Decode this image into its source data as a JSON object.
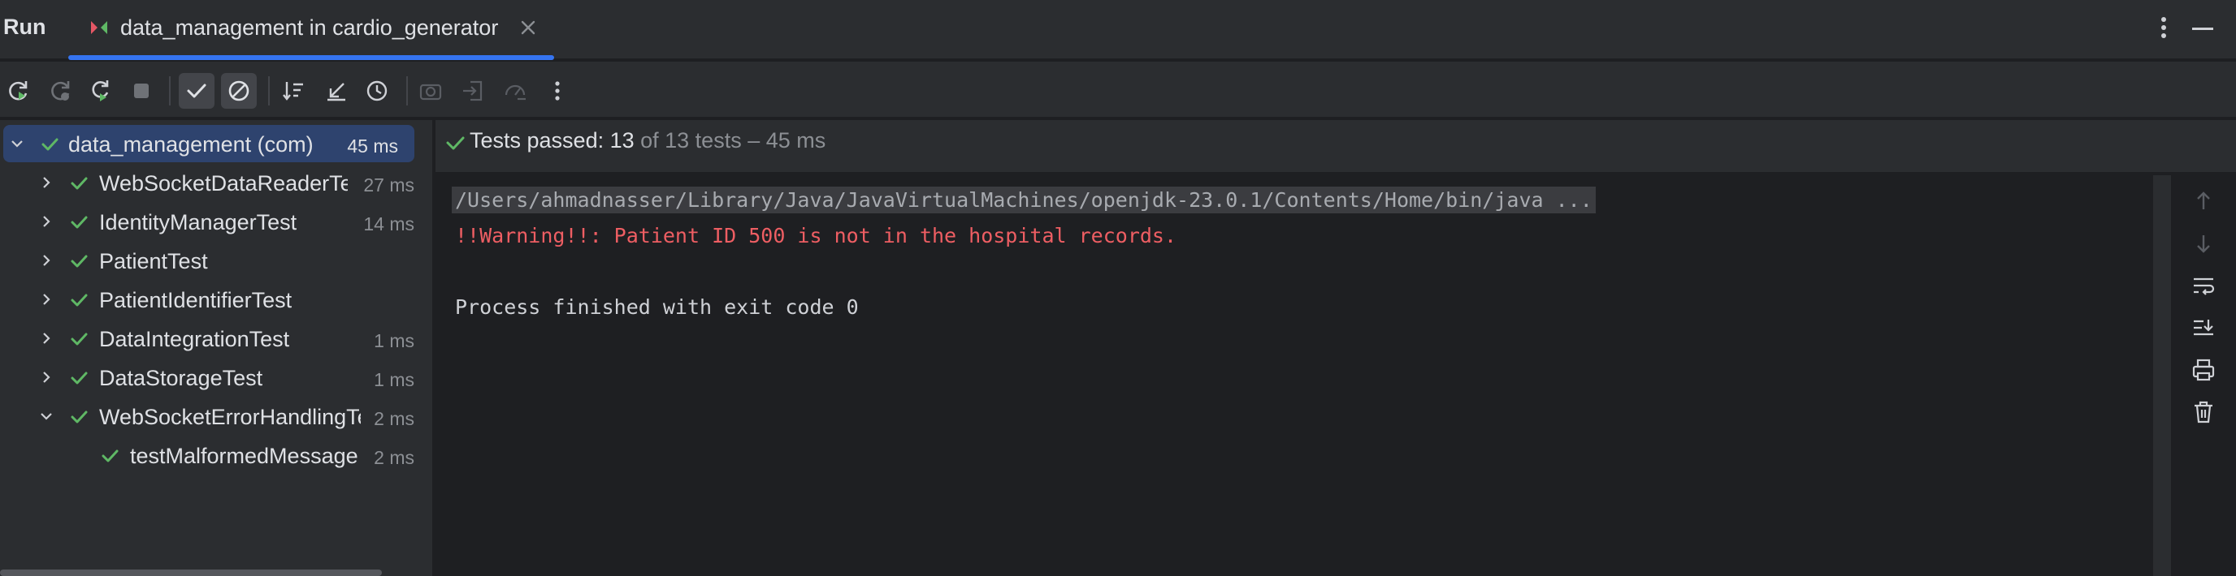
{
  "header": {
    "run_title": "Run",
    "tab_label": "data_management in cardio_generator"
  },
  "status": {
    "label": "Tests passed: 13",
    "rest": " of 13 tests – 45 ms"
  },
  "tree": {
    "rows": [
      {
        "label": "data_management (com)",
        "time": "45 ms"
      },
      {
        "label": "WebSocketDataReaderTest",
        "time": "27 ms"
      },
      {
        "label": "IdentityManagerTest",
        "time": "14 ms"
      },
      {
        "label": "PatientTest",
        "time": ""
      },
      {
        "label": "PatientIdentifierTest",
        "time": ""
      },
      {
        "label": "DataIntegrationTest",
        "time": "1 ms"
      },
      {
        "label": "DataStorageTest",
        "time": "1 ms"
      },
      {
        "label": "WebSocketErrorHandlingTest",
        "time": "2 ms"
      },
      {
        "label": "testMalformedMessage",
        "time": "2 ms"
      }
    ]
  },
  "console": {
    "command": "/Users/ahmadnasser/Library/Java/JavaVirtualMachines/openjdk-23.0.1/Contents/Home/bin/java ...",
    "warning": "!!Warning!!: Patient ID 500 is not in the hospital records.",
    "finished": "Process finished with exit code 0"
  },
  "colors": {
    "accent": "#3574f0",
    "success": "#5fb865",
    "error": "#ee5e63",
    "selection": "#2e436e"
  },
  "icons": {
    "toolbar": [
      "rerun-icon",
      "rerun-failed-icon",
      "toggle-auto-test-icon",
      "stop-icon",
      "show-passed-icon",
      "show-ignored-icon",
      "sort-alphabetically-icon",
      "collapse-all-icon",
      "sort-by-duration-icon",
      "screenshot-icon",
      "import-tests-icon",
      "export-tests-icon",
      "more-icon"
    ],
    "console_side": [
      "scroll-up-icon",
      "scroll-down-icon",
      "soft-wrap-icon",
      "scroll-to-end-icon",
      "print-icon",
      "clear-icon"
    ]
  }
}
